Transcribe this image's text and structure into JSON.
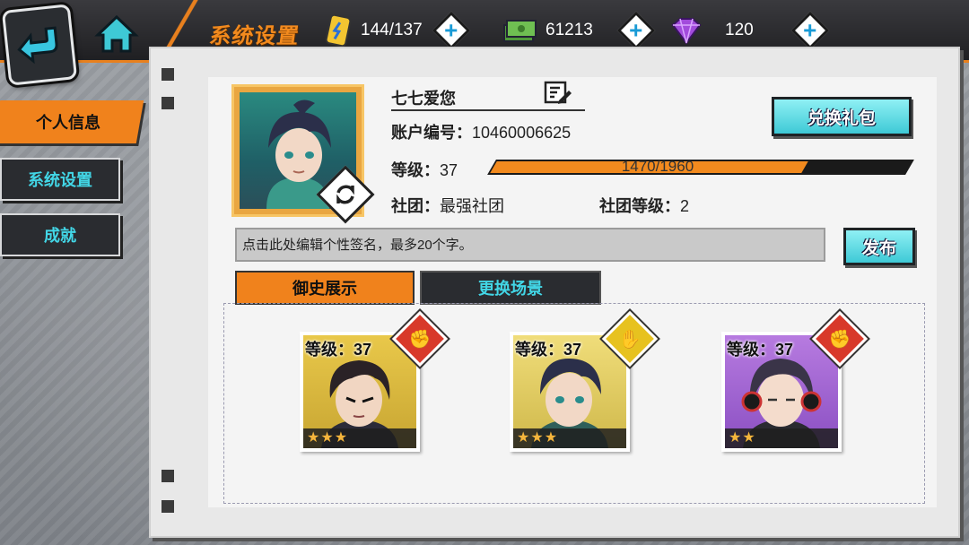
{
  "header": {
    "title": "系统设置",
    "stamina": "144/137",
    "cash": "61213",
    "gems": "120"
  },
  "nav": {
    "items": [
      {
        "label": "个人信息",
        "active": true
      },
      {
        "label": "系统设置",
        "active": false
      },
      {
        "label": "成就",
        "active": false
      }
    ]
  },
  "profile": {
    "name": "七七爱您",
    "account_label": "账户编号：",
    "account_id": "10460006625",
    "level_label": "等级：",
    "level": "37",
    "exp_text": "1470/1960",
    "exp_fraction": 0.75,
    "club_label": "社团：",
    "club": "最强社团",
    "club_level_label": "社团等级：",
    "club_level": "2",
    "redeem_button": "兑换礼包",
    "signature_placeholder": "点击此处编辑个性签名，最多20个字。",
    "publish_button": "发布"
  },
  "tabs": [
    {
      "label": "御史展示",
      "selected": true
    },
    {
      "label": "更换场景",
      "selected": false
    }
  ],
  "cards": [
    {
      "level": "等级：37",
      "stars": "★★★",
      "hand": "✊",
      "hand_color": "#d8392a"
    },
    {
      "level": "等级：37",
      "stars": "★★★",
      "hand": "✋",
      "hand_color": "#e7c21f"
    },
    {
      "level": "等级：37",
      "stars": "★★",
      "hand": "✊",
      "hand_color": "#d8392a"
    }
  ],
  "colors": {
    "accent": "#f0821c",
    "cyan": "#42d6e6"
  }
}
